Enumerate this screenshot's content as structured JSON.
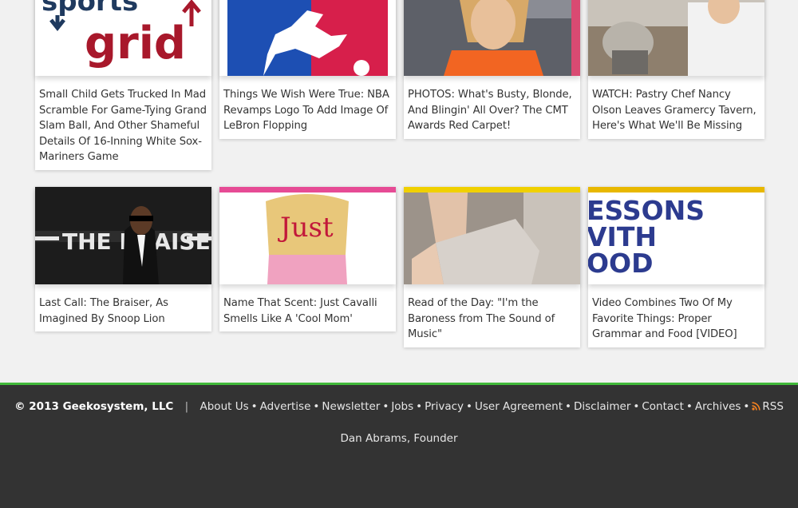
{
  "colors": {
    "footer_bg": "#333333",
    "footer_accent": "#41b93a",
    "page_bg": "#f1f1f1",
    "pink_bar": "#e64b95",
    "yellow_bar": "#f0d000",
    "rss_orange": "#f58220"
  },
  "articles": [
    {
      "title": "Small Child Gets Trucked In Mad Scramble For Game-Tying Grand Slam Ball, And Other Shameful Details Of 16-Inning White Sox-Mariners Game",
      "thumb_logo_top": "sports",
      "thumb_logo_main": "grid"
    },
    {
      "title": "Things We Wish Were True: NBA Revamps Logo To Add Image Of LeBron Flopping"
    },
    {
      "title": "PHOTOS: What's Busty, Blonde, And Blingin' All Over? The CMT Awards Red Carpet!"
    },
    {
      "title": "WATCH: Pastry Chef Nancy Olson Leaves Gramercy Tavern, Here's What We'll Be Missing"
    },
    {
      "title": "Last Call: The Braiser, As Imagined By Snoop Lion",
      "thumb_text": "THE BRAISER"
    },
    {
      "title": "Name That Scent: Just Cavalli Smells Like A 'Cool Mom'",
      "thumb_text": "Just"
    },
    {
      "title": "Read of the Day: \"I'm the Baroness from The Sound of Music\""
    },
    {
      "title": "Video Combines Two Of My Favorite Things: Proper Grammar and Food [VIDEO]",
      "thumb_lines": [
        "ESSONS",
        "VITH",
        "OOD"
      ]
    }
  ],
  "footer": {
    "copyright": "© 2013 Geekosystem, LLC",
    "separator": "|",
    "links": [
      "About Us",
      "Advertise",
      "Newsletter",
      "Jobs",
      "Privacy",
      "User Agreement",
      "Disclaimer",
      "Contact",
      "Archives"
    ],
    "rss_label": "RSS",
    "founder": "Dan Abrams, Founder"
  }
}
